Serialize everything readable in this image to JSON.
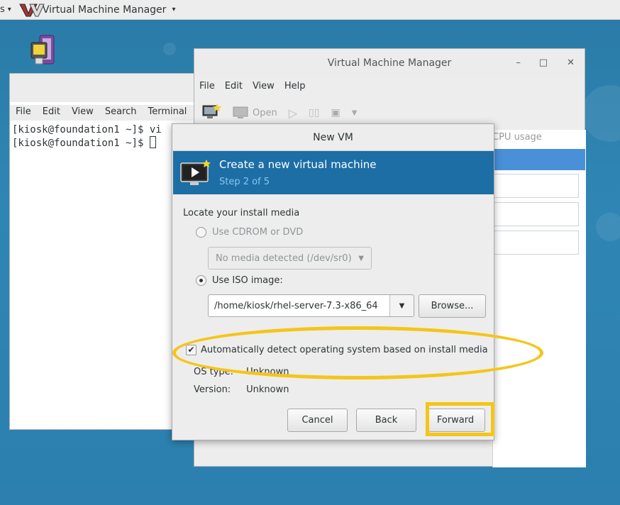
{
  "topbar": {
    "activities_label": "s",
    "activities_caret": "▾",
    "app_title": "Virtual Machine Manager",
    "app_caret": "▾"
  },
  "terminal": {
    "menu": [
      "File",
      "Edit",
      "View",
      "Search",
      "Terminal"
    ],
    "lines": [
      "[kiosk@foundation1 ~]$ vi",
      "[kiosk@foundation1 ~]$ "
    ]
  },
  "vmm": {
    "title": "Virtual Machine Manager",
    "controls": {
      "minimize": "–",
      "maximize": "□",
      "close": "✕"
    },
    "menu": [
      "File",
      "Edit",
      "View",
      "Help"
    ],
    "toolbar": {
      "open_label": "Open"
    },
    "cpu_header": "CPU usage"
  },
  "dialog": {
    "title": "New VM",
    "banner_title": "Create a new virtual machine",
    "banner_step": "Step 2 of 5",
    "section_label": "Locate your install media",
    "cdrom_label": "Use CDROM or DVD",
    "cdrom_combo": "No media detected (/dev/sr0)",
    "iso_label": "Use ISO image:",
    "iso_value": "/home/kiosk/rhel-server-7.3-x86_64",
    "browse_label": "Browse...",
    "auto_detect_label": "Automatically detect operating system based on install media",
    "auto_detect_checked": true,
    "os_type_key": "OS type:",
    "os_type_value": "Unknown",
    "version_key": "Version:",
    "version_value": "Unknown",
    "cancel_label": "Cancel",
    "back_label": "Back",
    "forward_label": "Forward"
  },
  "colors": {
    "banner": "#1c6ea5",
    "highlight": "#f5c518",
    "desktop": "#2c7faf"
  }
}
